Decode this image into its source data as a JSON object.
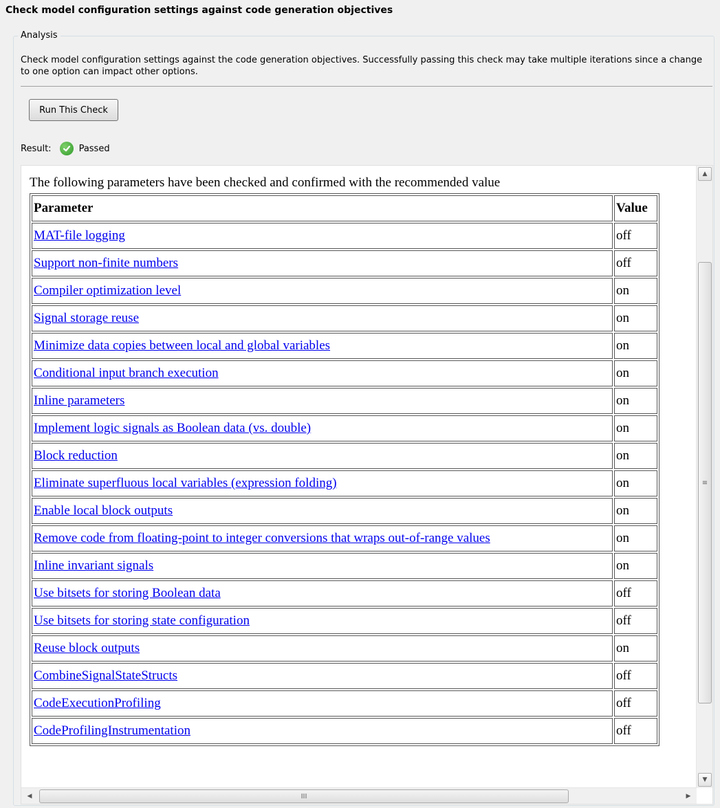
{
  "title": "Check model configuration settings against code generation objectives",
  "analysis": {
    "legend": "Analysis",
    "description": "Check model configuration settings against the code generation objectives. Successfully passing this check may take multiple iterations since a change to one option can impact other options.",
    "run_button_label": "Run This Check"
  },
  "result": {
    "label": "Result:",
    "status": "Passed",
    "status_color": "#2f9a2a"
  },
  "report": {
    "intro": "The following parameters have been checked and confirmed with the recommended value",
    "headers": {
      "parameter": "Parameter",
      "value": "Value"
    },
    "rows": [
      {
        "parameter": "MAT-file logging",
        "value": "off"
      },
      {
        "parameter": "Support non-finite numbers",
        "value": "off"
      },
      {
        "parameter": "Compiler optimization level",
        "value": "on"
      },
      {
        "parameter": "Signal storage reuse",
        "value": "on"
      },
      {
        "parameter": "Minimize data copies between local and global variables",
        "value": "on"
      },
      {
        "parameter": "Conditional input branch execution",
        "value": "on"
      },
      {
        "parameter": "Inline parameters",
        "value": "on"
      },
      {
        "parameter": "Implement logic signals as Boolean data (vs. double)",
        "value": "on"
      },
      {
        "parameter": "Block reduction",
        "value": "on"
      },
      {
        "parameter": "Eliminate superfluous local variables (expression folding)",
        "value": "on"
      },
      {
        "parameter": "Enable local block outputs",
        "value": "on"
      },
      {
        "parameter": "Remove code from floating-point to integer conversions that wraps out-of-range values",
        "value": "on"
      },
      {
        "parameter": "Inline invariant signals",
        "value": "on"
      },
      {
        "parameter": "Use bitsets for storing Boolean data",
        "value": "off"
      },
      {
        "parameter": "Use bitsets for storing state configuration",
        "value": "off"
      },
      {
        "parameter": "Reuse block outputs",
        "value": "on"
      },
      {
        "parameter": "CombineSignalStateStructs",
        "value": "off"
      },
      {
        "parameter": "CodeExecutionProfiling",
        "value": "off"
      },
      {
        "parameter": "CodeProfilingInstrumentation",
        "value": "off"
      }
    ]
  },
  "scrollbars": {
    "up_icon": "▲",
    "down_icon": "▼",
    "left_icon": "◀",
    "right_icon": "▶",
    "v_grip": "≡",
    "h_grip": "III"
  }
}
